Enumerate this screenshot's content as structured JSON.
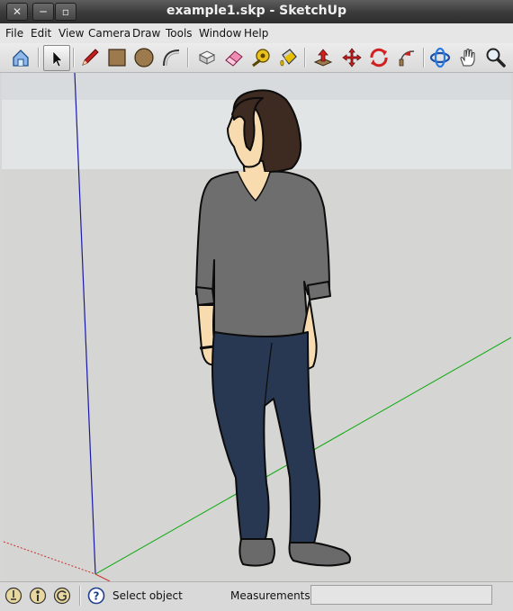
{
  "window": {
    "title": "example1.skp - SketchUp",
    "close_glyph": "✕",
    "minimize_glyph": "─",
    "maximize_glyph": "▫"
  },
  "menu": {
    "items": [
      "File",
      "Edit",
      "View",
      "Camera",
      "Draw",
      "Tools",
      "Window",
      "Help"
    ]
  },
  "toolbar": {
    "tools": [
      {
        "name": "get-models-icon"
      },
      {
        "name": "select-arrow-icon",
        "active": true
      },
      {
        "name": "pencil-line-icon"
      },
      {
        "name": "rectangle-icon"
      },
      {
        "name": "circle-icon"
      },
      {
        "name": "arc-icon"
      },
      {
        "name": "make-component-icon"
      },
      {
        "name": "eraser-icon"
      },
      {
        "name": "tape-measure-icon"
      },
      {
        "name": "paint-bucket-icon"
      },
      {
        "name": "push-pull-icon"
      },
      {
        "name": "move-icon"
      },
      {
        "name": "rotate-icon"
      },
      {
        "name": "follow-me-icon"
      },
      {
        "name": "orbit-icon"
      },
      {
        "name": "pan-hand-icon"
      },
      {
        "name": "zoom-icon"
      }
    ]
  },
  "viewport": {
    "sky_color": "#e2e5e6",
    "ground_color": "#d5d5d3",
    "axis_blue": "#1a1aa8",
    "axis_green": "#0aa80a",
    "axis_red": "#c83030",
    "model": "person figure"
  },
  "status": {
    "icons": [
      "geo-location-icon",
      "credits-icon",
      "sign-in-icon",
      "instructor-help-icon"
    ],
    "text": "Select object",
    "measurements_label": "Measurements",
    "measurements_value": ""
  }
}
